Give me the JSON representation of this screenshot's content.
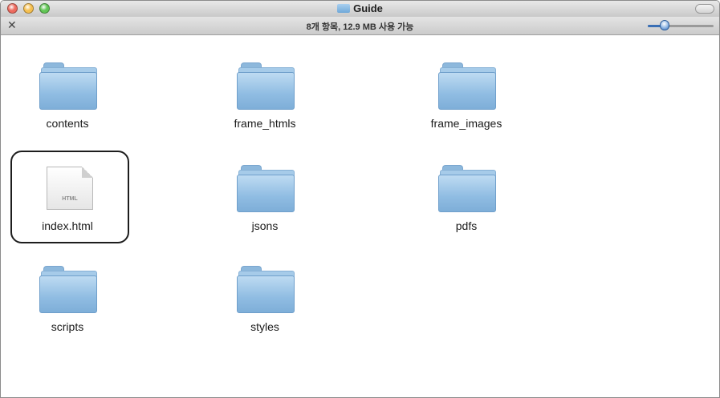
{
  "window": {
    "title": "Guide",
    "status": "8개 항목, 12.9 MB 사용 가능"
  },
  "colors": {
    "close": "#ed6a5e",
    "minimize": "#f5bf4f",
    "zoom": "#61c554",
    "highlight": "#1d1d1d"
  },
  "files": [
    {
      "name": "contents",
      "type": "folder",
      "icon": "folder-icon"
    },
    {
      "name": "frame_htmls",
      "type": "folder",
      "icon": "folder-icon"
    },
    {
      "name": "frame_images",
      "type": "folder",
      "icon": "folder-icon"
    },
    {
      "name": "index.html",
      "type": "html",
      "icon": "html-file-icon",
      "icon_text": "HTML"
    },
    {
      "name": "jsons",
      "type": "folder",
      "icon": "folder-icon"
    },
    {
      "name": "pdfs",
      "type": "folder",
      "icon": "folder-icon"
    },
    {
      "name": "scripts",
      "type": "folder",
      "icon": "folder-icon"
    },
    {
      "name": "styles",
      "type": "folder",
      "icon": "folder-icon"
    }
  ]
}
